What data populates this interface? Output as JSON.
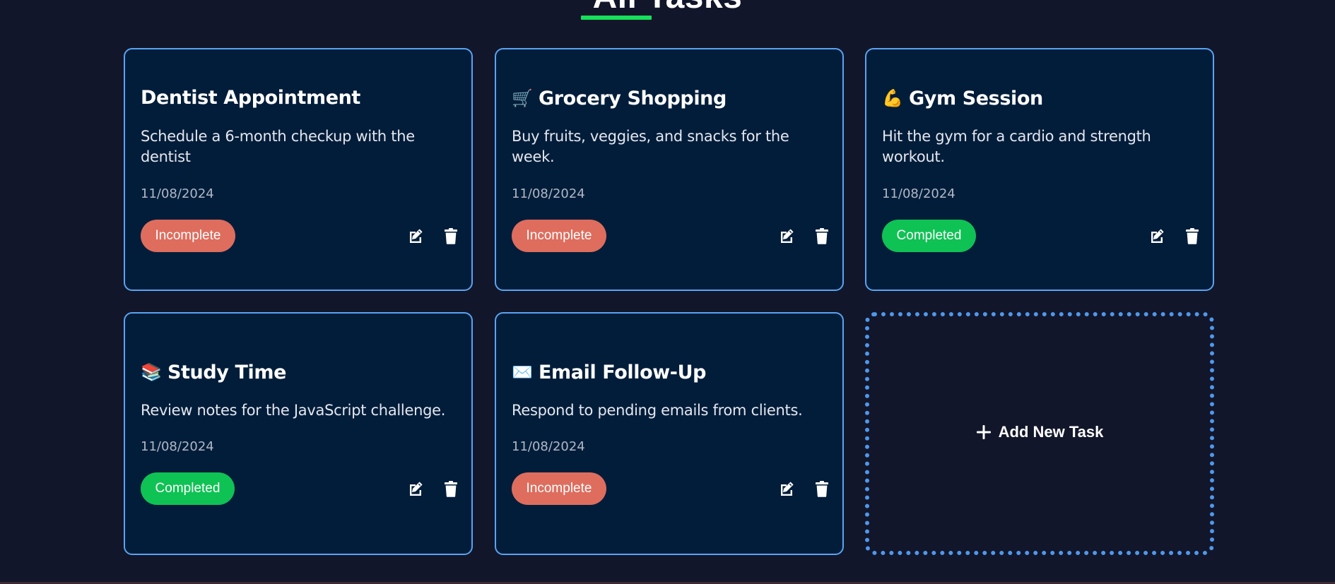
{
  "page": {
    "heading": "All Tasks",
    "accent_color": "#16e05a"
  },
  "tasks": [
    {
      "emoji": "",
      "title": "Dentist Appointment",
      "description": "Schedule a 6-month checkup with the dentist",
      "date": "11/08/2024",
      "status": "Incomplete",
      "status_color": "#de6d5e"
    },
    {
      "emoji": "🛒",
      "title": "Grocery Shopping",
      "description": "Buy fruits, veggies, and snacks for the week.",
      "date": "11/08/2024",
      "status": "Incomplete",
      "status_color": "#de6d5e"
    },
    {
      "emoji": "💪",
      "title": "Gym Session",
      "description": "Hit the gym for a cardio and strength workout.",
      "date": "11/08/2024",
      "status": "Completed",
      "status_color": "#0fc254"
    },
    {
      "emoji": "📚",
      "title": "Study Time",
      "description": "Review notes for the JavaScript challenge.",
      "date": "11/08/2024",
      "status": "Completed",
      "status_color": "#0fc254"
    },
    {
      "emoji": "✉️",
      "title": "Email Follow-Up",
      "description": "Respond to pending emails from clients.",
      "date": "11/08/2024",
      "status": "Incomplete",
      "status_color": "#de6d5e"
    }
  ],
  "add_task": {
    "label": "Add New Task",
    "icon": "plus-icon"
  },
  "icons": {
    "edit": "edit-icon",
    "delete": "trash-icon"
  }
}
